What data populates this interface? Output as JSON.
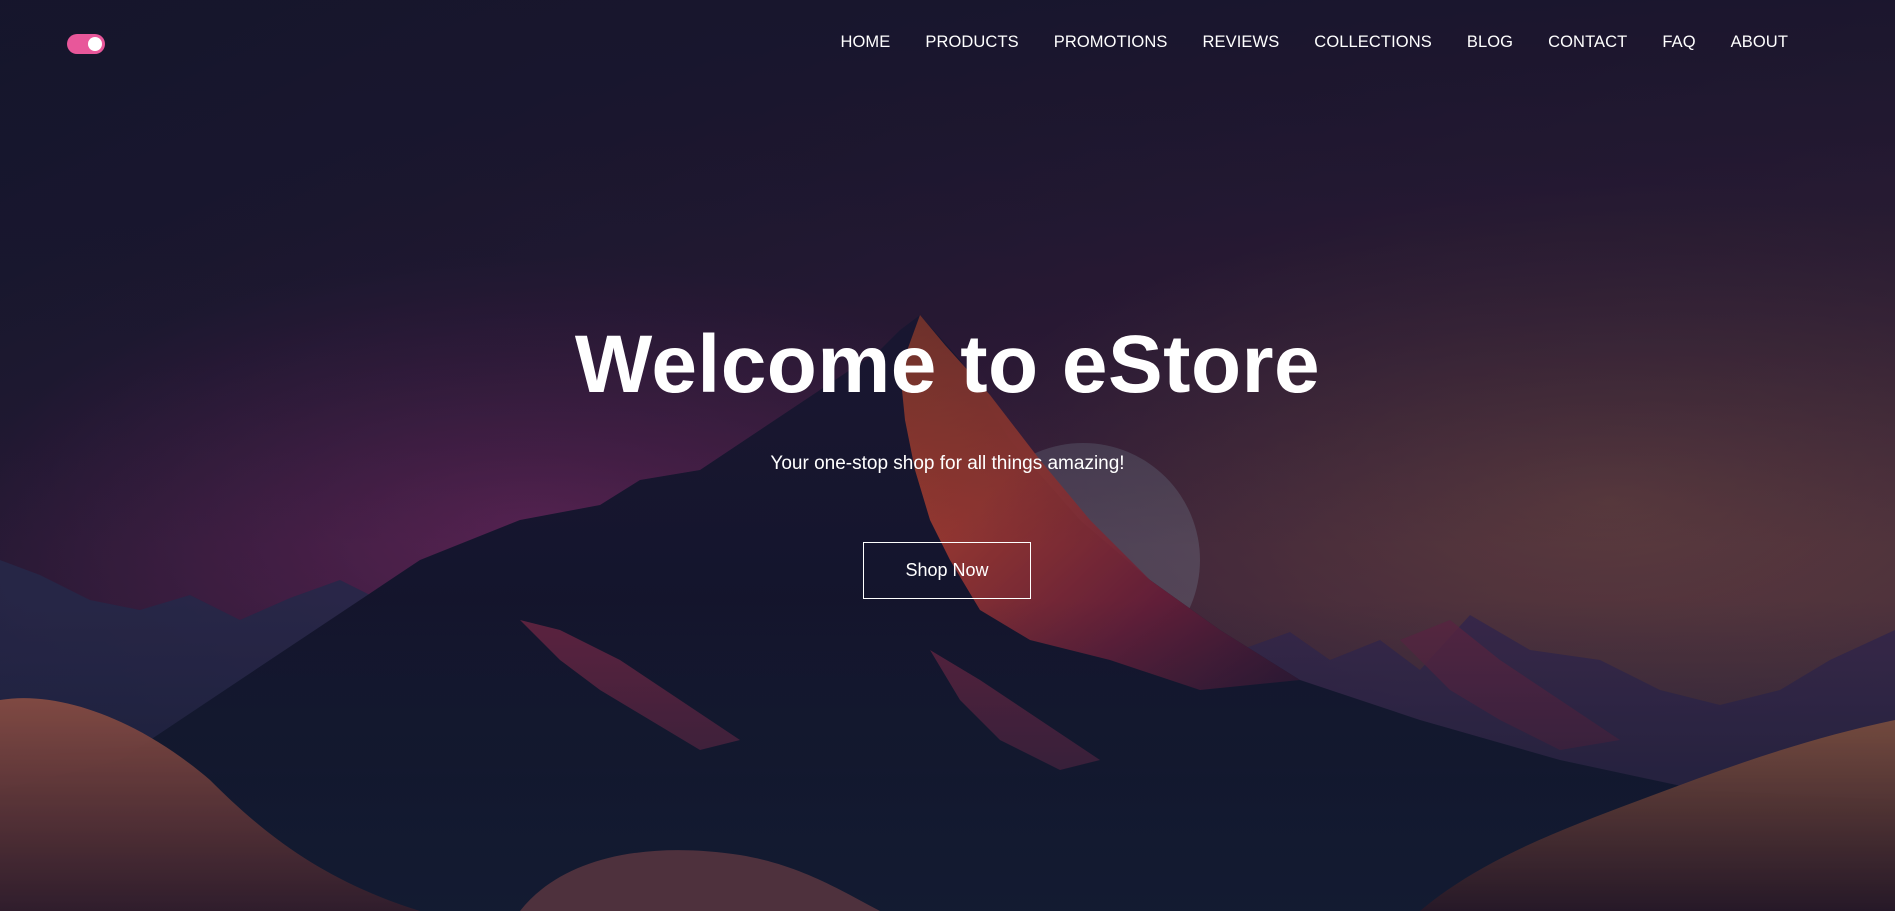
{
  "theme_toggle": {
    "state": "on",
    "color": "#e8579a"
  },
  "nav": {
    "items": [
      {
        "label": "HOME"
      },
      {
        "label": "PRODUCTS"
      },
      {
        "label": "PROMOTIONS"
      },
      {
        "label": "REVIEWS"
      },
      {
        "label": "COLLECTIONS"
      },
      {
        "label": "BLOG"
      },
      {
        "label": "CONTACT"
      },
      {
        "label": "FAQ"
      },
      {
        "label": "ABOUT"
      }
    ]
  },
  "hero": {
    "title": "Welcome to eStore",
    "subtitle": "Your one-stop shop for all things amazing!",
    "cta_label": "Shop Now"
  }
}
